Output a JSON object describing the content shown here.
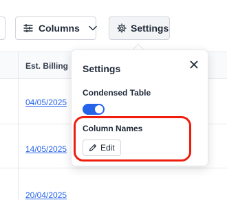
{
  "toolbar": {
    "columns_label": "Columns",
    "settings_label": "Settings"
  },
  "table": {
    "header": "Est. Billing D",
    "rows": [
      {
        "billing_date": "04/05/2025"
      },
      {
        "billing_date": "14/05/2025"
      },
      {
        "billing_date": "20/04/2025"
      }
    ]
  },
  "settings_popover": {
    "title": "Settings",
    "condensed_label": "Condensed Table",
    "condensed_enabled": true,
    "column_names_label": "Column Names",
    "edit_label": "Edit"
  },
  "colors": {
    "accent": "#2563eb",
    "highlight": "#ee1d0e"
  },
  "icons": {
    "columns": "sliders-icon",
    "settings": "gear-icon",
    "dropdown": "chevron-down-icon",
    "close": "close-icon",
    "edit": "pencil-icon"
  }
}
